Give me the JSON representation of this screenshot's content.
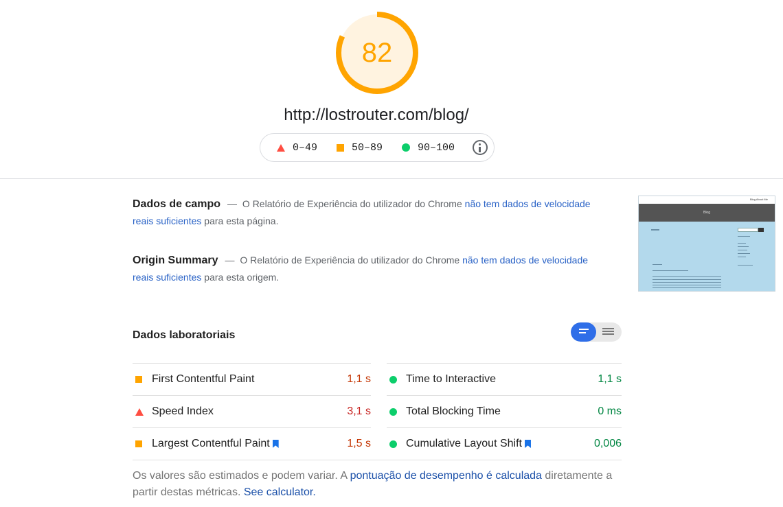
{
  "score": {
    "value": "82",
    "fraction": 0.82,
    "color": "#ffa400",
    "track_color": "#fff3e0"
  },
  "url": "http://lostrouter.com/blog/",
  "legend": [
    {
      "icon": "red-triangle-icon",
      "range": "0–49",
      "color": "#ff4e42"
    },
    {
      "icon": "orange-square-icon",
      "range": "50–89",
      "color": "#ffa400"
    },
    {
      "icon": "green-circle-icon",
      "range": "90–100",
      "color": "#0cce6b"
    }
  ],
  "field_data": {
    "title": "Dados de campo",
    "dash": "—",
    "text": "O Relatório de Experiência do utilizador do Chrome",
    "link": "não tem dados de velocidade reais suficientes",
    "suffix": "para esta página."
  },
  "origin_summary": {
    "title": "Origin Summary",
    "dash": "—",
    "text": "O Relatório de Experiência do utilizador do Chrome",
    "link": "não tem dados de velocidade reais suficientes",
    "suffix": "para esta origem."
  },
  "thumbnail": {
    "nav_links": "Blog   About Me",
    "banner": "Blog"
  },
  "lab_data": {
    "title": "Dados laboratoriais",
    "metrics_left": [
      {
        "name": "First Contentful Paint",
        "value": "1,1 s",
        "status": "average"
      },
      {
        "name": "Speed Index",
        "value": "3,1 s",
        "status": "fail"
      },
      {
        "name": "Largest Contentful Paint",
        "value": "1,5 s",
        "status": "average"
      }
    ],
    "metrics_right": [
      {
        "name": "Time to Interactive",
        "value": "1,1 s",
        "status": "pass"
      },
      {
        "name": "Total Blocking Time",
        "value": "0 ms",
        "status": "pass"
      },
      {
        "name": "Cumulative Layout Shift",
        "value": "0,006",
        "status": "pass"
      }
    ]
  },
  "footer": {
    "text1": "Os valores são estimados e podem variar. A",
    "link1": "pontuação de desempenho é calculada",
    "text2": "diretamente a partir destas métricas.",
    "link2": "See calculator."
  }
}
